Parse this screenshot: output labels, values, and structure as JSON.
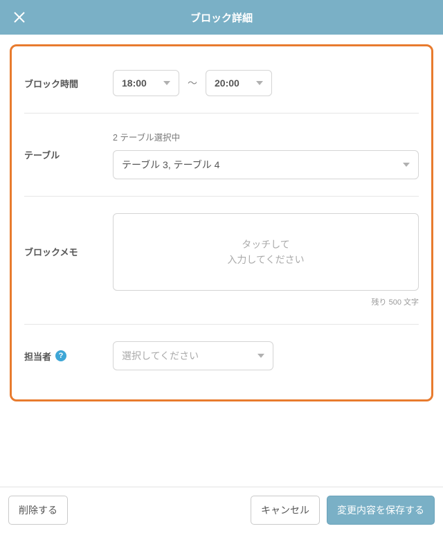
{
  "header": {
    "title": "ブロック詳細"
  },
  "blockTime": {
    "label": "ブロック時間",
    "start": "18:00",
    "separator": "〜",
    "end": "20:00"
  },
  "table": {
    "label": "テーブル",
    "hint": "2 テーブル選択中",
    "value": "テーブル 3, テーブル 4"
  },
  "memo": {
    "label": "ブロックメモ",
    "placeholder_line1": "タッチして",
    "placeholder_line2": "入力してください",
    "remaining": "残り 500 文字"
  },
  "staff": {
    "label": "担当者",
    "placeholder": "選択してください"
  },
  "footer": {
    "delete": "削除する",
    "cancel": "キャンセル",
    "save": "変更内容を保存する"
  }
}
